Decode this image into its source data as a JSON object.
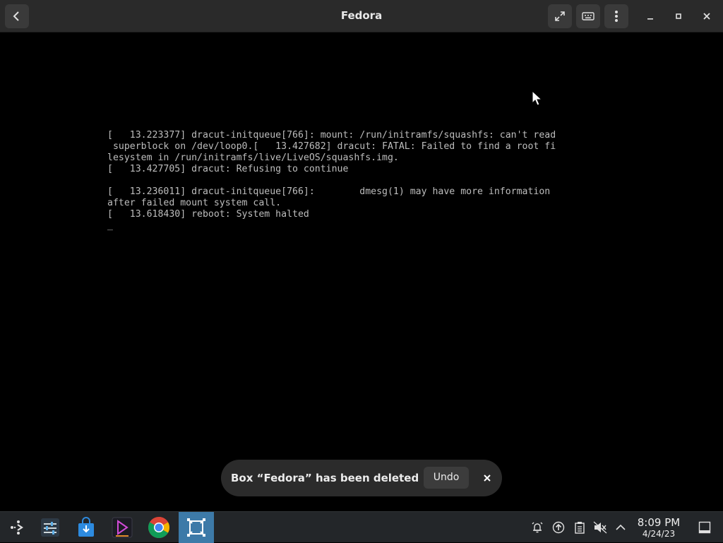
{
  "window": {
    "title": "Fedora"
  },
  "titlebar": {
    "back_icon": "chevron-left-icon",
    "fullscreen_icon": "expand-icon",
    "keyboard_icon": "keyboard-icon",
    "menu_icon": "kebab-menu-icon",
    "minimize_icon": "minimize-icon",
    "maximize_icon": "maximize-icon",
    "close_icon": "close-icon"
  },
  "terminal": {
    "lines": [
      "[   13.223377] dracut-initqueue[766]: mount: /run/initramfs/squashfs: can't read",
      " superblock on /dev/loop0.[   13.427682] dracut: FATAL: Failed to find a root fi",
      "lesystem in /run/initramfs/live/LiveOS/squashfs.img.",
      "[   13.427705] dracut: Refusing to continue",
      "",
      "[   13.236011] dracut-initqueue[766]:        dmesg(1) may have more information",
      "after failed mount system call.",
      "[   13.618430] reboot: System halted",
      "_"
    ]
  },
  "toast": {
    "message": "Box “Fedora” has been deleted",
    "undo_label": "Undo",
    "close_icon": "close-icon"
  },
  "taskbar": {
    "apps": [
      {
        "name": "application-launcher",
        "icon": "launcher-icon"
      },
      {
        "name": "system-settings",
        "icon": "settings-sliders-icon"
      },
      {
        "name": "software-store",
        "icon": "store-bag-icon"
      },
      {
        "name": "media-player",
        "icon": "play-icon"
      },
      {
        "name": "chrome-browser",
        "icon": "chrome-icon"
      },
      {
        "name": "boxes",
        "icon": "boxes-icon"
      }
    ],
    "tray": [
      "alarm-icon",
      "update-icon",
      "clipboard-icon",
      "volume-muted-icon",
      "chevron-up-icon"
    ],
    "clock": {
      "time": "8:09 PM",
      "date": "4/24/23"
    },
    "show_desktop_icon": "desktop-icon",
    "colors": {
      "active": "#3d7aa8",
      "background": "#232629"
    }
  }
}
